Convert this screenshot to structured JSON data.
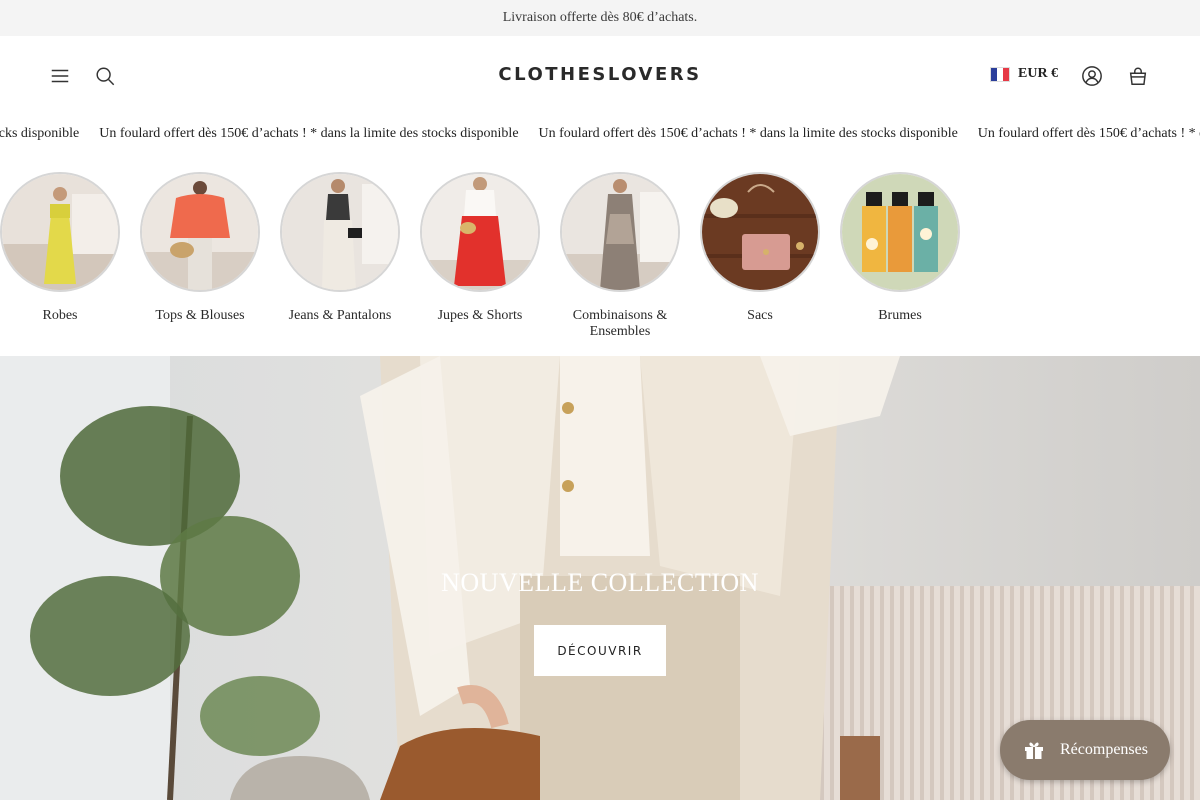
{
  "announcement": {
    "text": "Livraison offerte dès 80€ d’achats."
  },
  "header": {
    "logo": "CLOTHESLOVERS",
    "currency": "EUR €",
    "icons": {
      "menu": "hamburger-icon",
      "search": "search-icon",
      "account": "account-icon",
      "cart": "bag-icon",
      "flag": "flag-fr-icon"
    }
  },
  "marquee": {
    "items": [
      "Un foulard offert dès 150€ d’achats ! * dans la limite des stocks disponible",
      "Un foulard offert dès 150€ d’achats ! * dans la limite des stocks disponible",
      "Un foulard offert dès 150€ d’achats ! * dans la limite des stocks disponible",
      "Un foulard offert dès 150€ d’achats ! * dans la limite des stocks disponible"
    ]
  },
  "categories": [
    {
      "label": "Robes"
    },
    {
      "label": "Tops & Blouses"
    },
    {
      "label": "Jeans & Pantalons"
    },
    {
      "label": "Jupes & Shorts"
    },
    {
      "label": "Combinaisons & Ensembles"
    },
    {
      "label": "Sacs"
    },
    {
      "label": "Brumes"
    }
  ],
  "hero": {
    "title": "NOUVELLE COLLECTION",
    "button": "DÉCOUVRIR"
  },
  "rewards": {
    "label": "Récompenses",
    "icon": "gift-icon"
  },
  "colors": {
    "announcement_bg": "#f4f4f4",
    "rewards_bg": "#8a7b6d",
    "flag_blue": "#2b3e9a",
    "flag_red": "#e63946"
  }
}
